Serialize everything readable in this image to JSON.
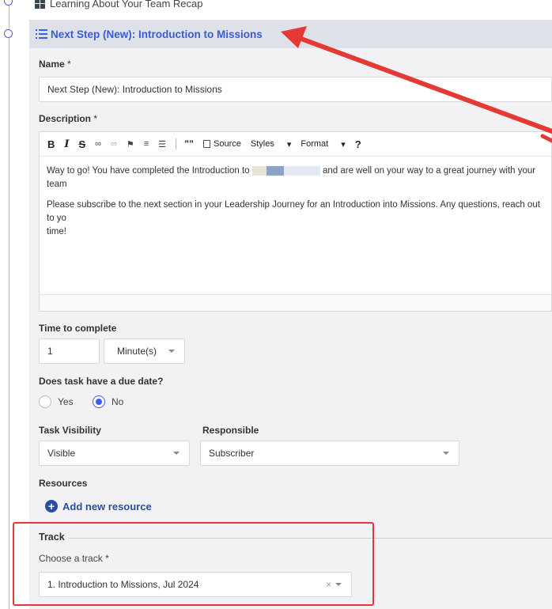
{
  "previous_step": {
    "title": "Learning About Your Team Recap"
  },
  "step": {
    "header_title": "Next Step (New): Introduction to Missions",
    "name": {
      "label": "Name",
      "required_mark": "*",
      "value": "Next Step (New): Introduction to Missions"
    },
    "description": {
      "label": "Description",
      "required_mark": "*",
      "toolbar": {
        "bold": "B",
        "italic": "I",
        "strike": "S",
        "quote": "””",
        "source": "Source",
        "styles": "Styles",
        "format": "Format",
        "help": "?"
      },
      "paragraph1_before": "Way to go! You have completed the Introduction to",
      "paragraph1_after": "and are well on your way to a great journey with your team",
      "paragraph2": "Please subscribe to the next section in your Leadership Journey for an Introduction into Missions. Any questions, reach out to yo",
      "paragraph2_cont": "time!"
    },
    "time_to_complete": {
      "label": "Time to complete",
      "value": "1",
      "unit": "Minute(s)"
    },
    "due_date": {
      "label": "Does task have a due date?",
      "options": [
        "Yes",
        "No"
      ],
      "selected": "No"
    },
    "task_visibility": {
      "label": "Task Visibility",
      "value": "Visible"
    },
    "responsible": {
      "label": "Responsible",
      "value": "Subscriber"
    },
    "resources": {
      "label": "Resources",
      "add_label": "Add new resource"
    },
    "track": {
      "section_label": "Track",
      "choose_label": "Choose a track",
      "required_mark": "*",
      "value": "1. Introduction to Missions, Jul 2024",
      "clear_symbol": "×"
    }
  },
  "colors": {
    "accent": "#3d5afe",
    "title_blue": "#3a5bd9",
    "annotation_red": "#e53935"
  }
}
